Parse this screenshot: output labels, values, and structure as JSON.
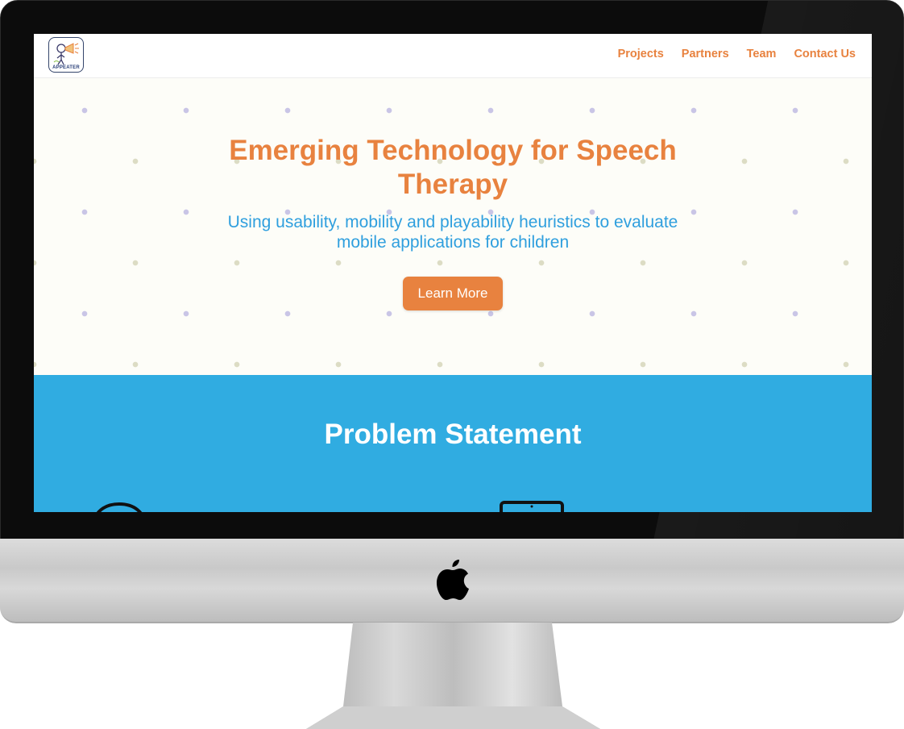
{
  "nav": {
    "logo_text": "APPEATER",
    "links": [
      "Projects",
      "Partners",
      "Team",
      "Contact Us"
    ]
  },
  "hero": {
    "title": "Emerging Technology for Speech Therapy",
    "subtitle": "Using usability, mobility and playability heuristics to evaluate mobile applications for children",
    "button_label": "Learn More"
  },
  "problem": {
    "title": "Problem Statement",
    "icons": [
      "chat-bubble-icon",
      "tablet-icon"
    ]
  },
  "device": {
    "icons": [
      "apple-logo-icon"
    ]
  },
  "colors": {
    "accent_orange": "#e8823f",
    "accent_blue": "#2f9fde",
    "section_blue": "#30ace1",
    "hero_background": "#fdfdf8"
  }
}
